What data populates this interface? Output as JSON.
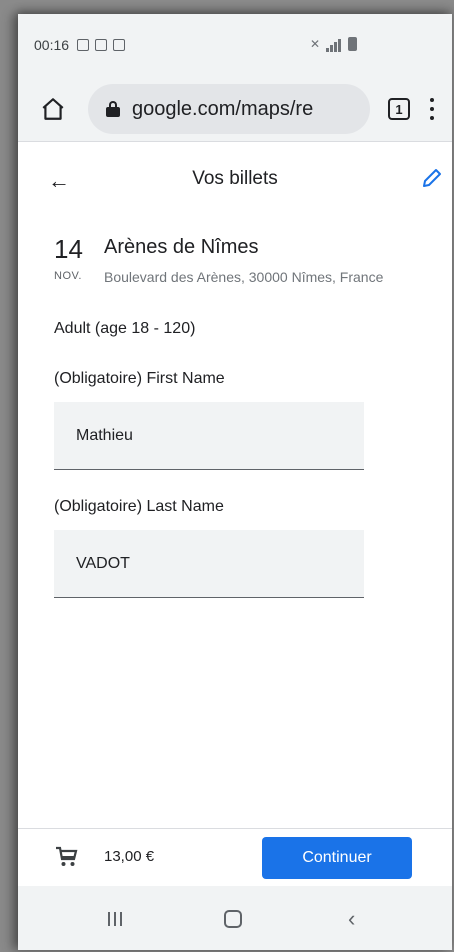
{
  "status_bar": {
    "time": "00:16"
  },
  "browser": {
    "url": "google.com/maps/re",
    "tab_count": "1"
  },
  "header": {
    "title": "Vos billets",
    "back_icon": "arrow-left-icon",
    "edit_icon": "pencil-icon"
  },
  "event": {
    "day": "14",
    "month": "NOV.",
    "name": "Arènes de Nîmes",
    "address": "Boulevard des Arènes, 30000 Nîmes, France"
  },
  "ticket": {
    "type": "Adult (age 18 - 120)"
  },
  "form": {
    "first_name_label": "(Obligatoire) First Name",
    "first_name_value": "Mathieu",
    "last_name_label": "(Obligatoire) Last Name",
    "last_name_value": "VADOT"
  },
  "footer": {
    "price": "13,00 €",
    "continue_label": "Continuer"
  },
  "colors": {
    "accent": "#1a73e8"
  }
}
